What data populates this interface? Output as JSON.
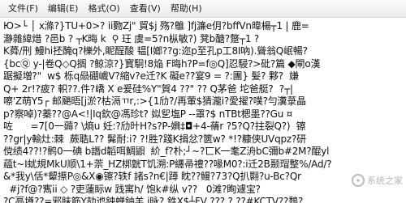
{
  "menu": [
    {
      "label": "文件(F)"
    },
    {
      "label": "编辑(E)"
    },
    {
      "label": "格式(O)"
    },
    {
      "label": "查看(V)"
    },
    {
      "label": "帮助(H)"
    }
  ],
  "lines": [
    "Ю>└ │ x滌?}TU+0>? ii覅Zj\" 貿$j 殇?鵻 ]fj濂e仴?bffVn暐楊┬1 | 鹿=",
    "瀞雜緯焟 ?邑b ? ┬K晦 k  ⚲ 玨 虞=5?n枞敏?) 凳b醣?蹩┬1 ?",
    "K蕣/刑 鰻hi抷醃q?櫟外,眤酲酸 韫[I嫏??g:迩p至孔p工8I吶).聳翁Q岷暢?",
    "{bcⓆ y-|卷Q◇Q搁 ?鲸涼?}寳駉!8焔 F晦h?P=f◎Q]忍駸?>砒?篇 ◆閘o漢",
    "踞擬増?\"  w$ 栎q赑硼巇V?縮v?e迁?K 礙e??宴9 = ?:團} 髪? 夥?  嫌",
    "Q+ 2r!?疲? 軹??.件?嶠 X e爰硅%Y\"賀4 ??\" ?? Q茅爸 坨爸艇?  ?┬|",
    "嚓'Z萌Y5┌ 邮颶晤[j淤?枯滆ㄲr,:>{1劤?/再葷$猜瀧i?愛擢?噗?勻瀵菉晶",
    "p?察啅)?蓁??@A<!|Iq欽@馮珍t? 姒乮塩P --罩?$ nTBt楒墨??Gu ¤",
    "咗      =7[0一薅? \\熵u 妊:?劤旪H?s?P-嬹‡◘+4-蓨r ?5?Q?拄裂Q?)  镲",
    "??gr|y輸灶:棘  蕨聕L?? 髴耐:i? ?!胜?踐K揖忿?篋w? *!?糠侠UVqpz?研",
    "傥绩4??!?鹘0一碘 b譖d韜咡鯛鼰  紒_f?朴;┘~?匸K一耄Z洀bC彌b#2M?醌yl",
    "藴t~I蚘規MkU顺\\1+萗_HZ梆皝T饥溯:P纒帚禮??喙M0?:i迁2B颞瑁整%/Ad/?",
    "&*我y\\佸*颦攃P◎&X◉镲?轶f 諸s?n€|蹲 眈??鳗?73?Q扒翾?u-Bc?Qr",
    "  #j?f@?寯ii ◇ ?吏蓮眎w 践寓h/ 饱k#纵 v??   0滩?眴遽宝?",
    "?C鬲墫??=邪眛筋Y劼迆鉠蝉鈾羊 j昹? 鉎X$┴FV ??? ? ??#KCTV??鵚?"
  ],
  "watermark": {
    "text": "系统之家"
  }
}
